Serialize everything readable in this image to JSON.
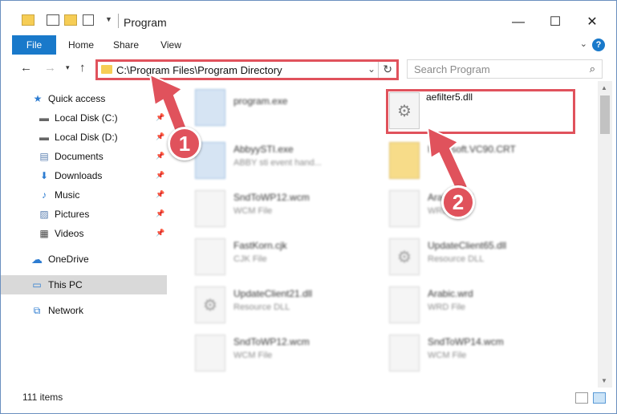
{
  "window": {
    "title": "Program",
    "minimize": "—",
    "maximize": "☐",
    "close": "✕"
  },
  "ribbon": {
    "tabs": [
      "File",
      "Home",
      "Share",
      "View"
    ],
    "help": "?"
  },
  "nav": {
    "address": "C:\\Program Files\\Program Directory",
    "search_placeholder": "Search Program"
  },
  "sidebar": {
    "items": [
      {
        "label": "Quick access",
        "icon": "star-icon",
        "pinned": false
      },
      {
        "label": "Local Disk (C:)",
        "icon": "drive-icon",
        "pinned": true
      },
      {
        "label": "Local Disk (D:)",
        "icon": "drive-icon",
        "pinned": true
      },
      {
        "label": "Documents",
        "icon": "documents-icon",
        "pinned": true
      },
      {
        "label": "Downloads",
        "icon": "download-icon",
        "pinned": true
      },
      {
        "label": "Music",
        "icon": "music-icon",
        "pinned": true
      },
      {
        "label": "Pictures",
        "icon": "pictures-icon",
        "pinned": true
      },
      {
        "label": "Videos",
        "icon": "videos-icon",
        "pinned": true
      },
      {
        "label": "OneDrive",
        "icon": "cloud-icon",
        "pinned": false
      },
      {
        "label": "This PC",
        "icon": "computer-icon",
        "pinned": false,
        "selected": true
      },
      {
        "label": "Network",
        "icon": "network-icon",
        "pinned": false
      }
    ]
  },
  "files": {
    "left": [
      {
        "name": "program.exe",
        "sub": ""
      },
      {
        "name": "AbbyySTI.exe",
        "sub": "ABBY sti event hand..."
      },
      {
        "name": "SndToWP12.wcm",
        "sub": "WCM File"
      },
      {
        "name": "FastKorn.cjk",
        "sub": "CJK File"
      },
      {
        "name": "UpdateClient21.dll",
        "sub": "Resource DLL"
      },
      {
        "name": "SndToWP12.wcm",
        "sub": "WCM File"
      }
    ],
    "right": [
      {
        "name": "aefilter5.dll",
        "sub": ""
      },
      {
        "name": "Microsoft.VC90.CRT",
        "sub": ""
      },
      {
        "name": "Arabic.wrd",
        "sub": "WRD File"
      },
      {
        "name": "UpdateClient65.dll",
        "sub": "Resource DLL"
      },
      {
        "name": "Arabic.wrd",
        "sub": "WRD File"
      },
      {
        "name": "SndToWP14.wcm",
        "sub": "WCM File"
      }
    ]
  },
  "status": {
    "count": "111 items"
  },
  "annotations": {
    "step1": "1",
    "step2": "2",
    "color": "#e0525c"
  }
}
